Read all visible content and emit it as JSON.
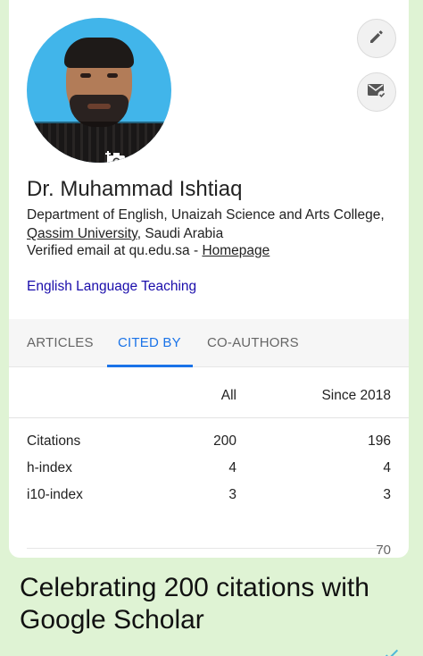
{
  "profile": {
    "name": "Dr. Muhammad Ishtiaq",
    "affiliation_part1": "Department of English, Unaizah Science and Arts College, ",
    "affiliation_link": "Qassim University",
    "affiliation_part2": ", Saudi Arabia",
    "email_text": "Verified email at qu.edu.sa - ",
    "homepage_link": "Homepage",
    "interest": "English Language Teaching"
  },
  "icons": {
    "edit": "pencil-icon",
    "follow": "email-check-icon",
    "camera": "camera-add-icon"
  },
  "tabs": [
    {
      "label": "ARTICLES",
      "active": false
    },
    {
      "label": "CITED BY",
      "active": true
    },
    {
      "label": "CO-AUTHORS",
      "active": false
    }
  ],
  "stats": {
    "headers": {
      "all": "All",
      "since": "Since 2018"
    },
    "rows": [
      {
        "label": "Citations",
        "all": "200",
        "since": "196"
      },
      {
        "label": "h-index",
        "all": "4",
        "since": "4"
      },
      {
        "label": "i10-index",
        "all": "3",
        "since": "3"
      }
    ],
    "chart_max": "70"
  },
  "caption": "Celebrating 200 citations with Google Scholar",
  "colors": {
    "accent": "#1a73e8",
    "link": "#1a0dab",
    "background": "#dff3d4"
  }
}
